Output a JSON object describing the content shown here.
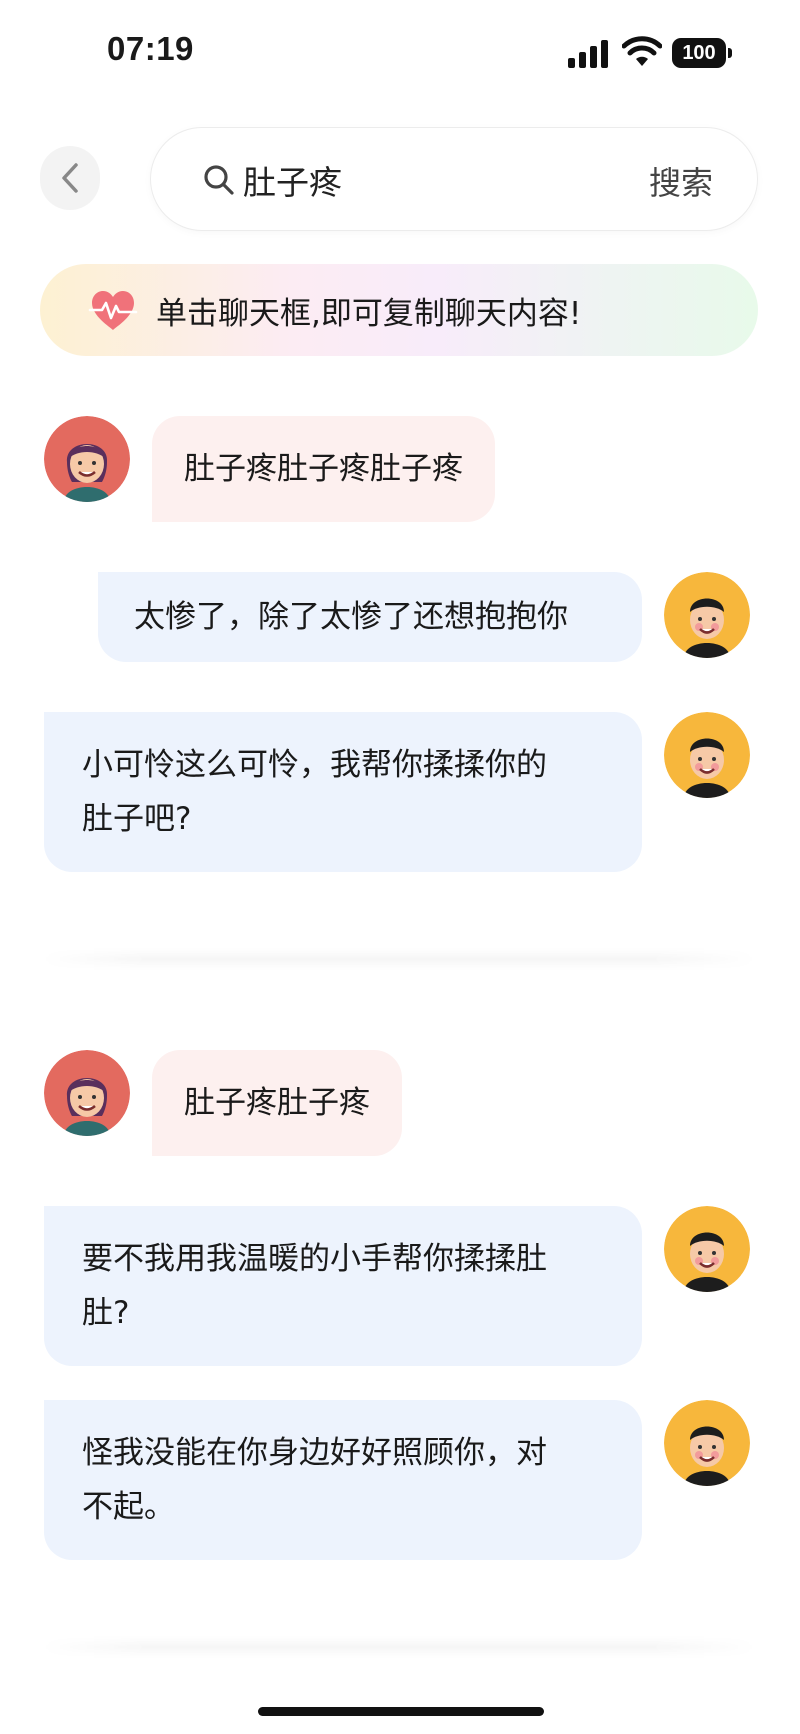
{
  "status_bar": {
    "time": "07:19",
    "battery": "100"
  },
  "search": {
    "query": "肚子疼",
    "button_label": "搜索"
  },
  "tip": {
    "text": "单击聊天框,即可复制聊天内容!"
  },
  "conversations": [
    {
      "messages": [
        {
          "sender": "user",
          "text": "肚子疼肚子疼肚子疼"
        },
        {
          "sender": "bot",
          "text": "太惨了，除了太惨了还想抱抱你"
        },
        {
          "sender": "bot",
          "line1": "小可怜这么可怜，我帮你揉揉你的",
          "line2": "肚子吧?"
        }
      ]
    },
    {
      "messages": [
        {
          "sender": "user",
          "text": "肚子疼肚子疼"
        },
        {
          "sender": "bot",
          "line1": "要不我用我温暖的小手帮你揉揉肚",
          "line2": "肚?"
        },
        {
          "sender": "bot",
          "line1": "怪我没能在你身边好好照顾你，对",
          "line2": "不起。"
        }
      ]
    }
  ],
  "colors": {
    "user_bubble": "#fdf0ef",
    "bot_bubble": "#edf3fd",
    "user_avatar_bg": "#e36a5f",
    "bot_avatar_bg": "#f7b73c"
  }
}
